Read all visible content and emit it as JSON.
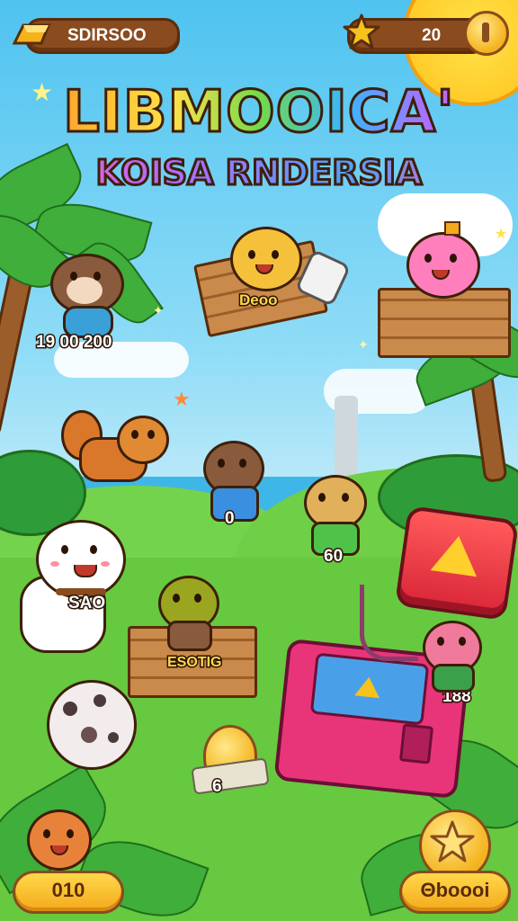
{
  "hud": {
    "currency_left": "SDIRSOO",
    "currency_right": "20"
  },
  "title": {
    "main": "LIBMOOICA'",
    "sub": "KOISA RNDERSIA"
  },
  "animals": [
    {
      "label": "19 00 200"
    },
    {
      "label": "Deoo"
    },
    {
      "label": "0"
    },
    {
      "label": "60"
    },
    {
      "label": "SAO"
    },
    {
      "label": "ESOTIG"
    },
    {
      "label": "6"
    },
    {
      "label": "188"
    }
  ],
  "bottom": {
    "left_button": "010",
    "right_button": "Θboooi"
  },
  "icons": {
    "gold_bar": "gold-bar-icon",
    "star": "star-icon",
    "coin": "coin-icon",
    "play": "play-icon",
    "star_button": "star-button-icon"
  },
  "colors": {
    "sky": "#4fc3f0",
    "grass": "#5cc53a",
    "wood": "#8a4b1e",
    "gold": "#f4b21c",
    "machine": "#e8357a",
    "play_button": "#e8363f"
  }
}
